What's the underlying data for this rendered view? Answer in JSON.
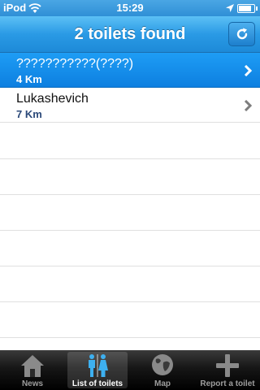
{
  "status_bar": {
    "carrier": "iPod",
    "time": "15:29",
    "battery_level": 0.85
  },
  "nav_bar": {
    "title": "2 toilets found",
    "refresh_icon": "refresh-icon"
  },
  "list": {
    "rows": [
      {
        "name": "???????????(????)",
        "distance": "4 Km",
        "selected": true
      },
      {
        "name": "Lukashevich",
        "distance": "7 Km",
        "selected": false
      }
    ]
  },
  "tab_bar": {
    "tabs": [
      {
        "label": "News",
        "icon": "house-icon",
        "active": false
      },
      {
        "label": "List of toilets",
        "icon": "toilet-sign-icon",
        "active": true
      },
      {
        "label": "Map",
        "icon": "globe-icon",
        "active": false
      },
      {
        "label": "Report a toilet",
        "icon": "plus-icon",
        "active": false
      }
    ]
  },
  "colors": {
    "nav_blue": "#2a9ae5",
    "selected_row": "#1e9df5",
    "distance_text": "#2c4a7a"
  }
}
